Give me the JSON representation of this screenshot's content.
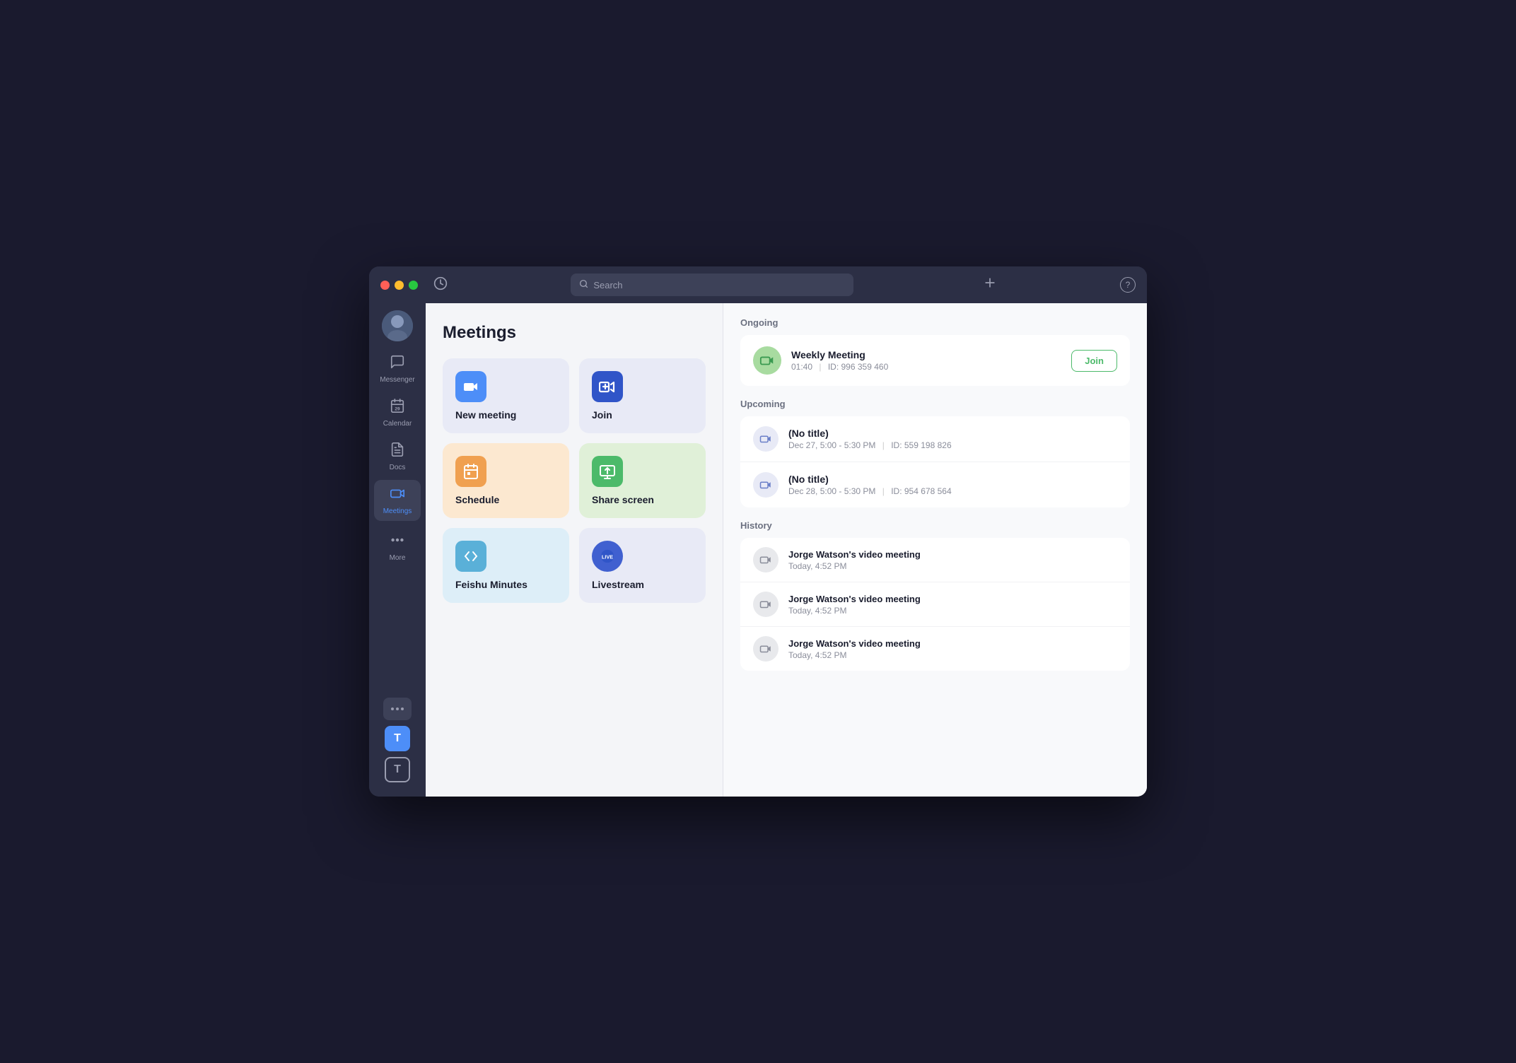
{
  "window": {
    "title": "Meetings"
  },
  "titlebar": {
    "search_placeholder": "Search",
    "help_label": "?"
  },
  "sidebar": {
    "items": [
      {
        "id": "messenger",
        "label": "Messenger",
        "icon": "💬"
      },
      {
        "id": "calendar",
        "label": "Calendar",
        "icon": "📅"
      },
      {
        "id": "docs",
        "label": "Docs",
        "icon": "📄"
      },
      {
        "id": "meetings",
        "label": "Meetings",
        "icon": "🎥",
        "active": true
      }
    ],
    "more_label": "More",
    "badge1": "T",
    "badge2": "T"
  },
  "main": {
    "title": "Meetings",
    "cards": [
      {
        "id": "new-meeting",
        "label": "New meeting",
        "bg": "card-blue",
        "icon_bg": "icon-bg-blue"
      },
      {
        "id": "join",
        "label": "Join",
        "bg": "card-blue",
        "icon_bg": "icon-bg-darkblue"
      },
      {
        "id": "schedule",
        "label": "Schedule",
        "bg": "card-orange",
        "icon_bg": "icon-bg-orange"
      },
      {
        "id": "share-screen",
        "label": "Share screen",
        "bg": "card-green",
        "icon_bg": "icon-bg-green"
      },
      {
        "id": "feishu-minutes",
        "label": "Feishu Minutes",
        "bg": "card-lightblue",
        "icon_bg": "icon-bg-lightblue"
      },
      {
        "id": "livestream",
        "label": "Livestream",
        "bg": "card-blue",
        "icon_bg": "icon-bg-blue2"
      }
    ]
  },
  "ongoing": {
    "section_label": "Ongoing",
    "meeting": {
      "name": "Weekly Meeting",
      "time": "01:40",
      "id_label": "ID: 996 359 460",
      "join_label": "Join"
    }
  },
  "upcoming": {
    "section_label": "Upcoming",
    "items": [
      {
        "title": "(No title)",
        "meta": "Dec 27, 5:00 - 5:30 PM",
        "id_label": "ID: 559 198 826"
      },
      {
        "title": "(No title)",
        "meta": "Dec 28, 5:00 - 5:30 PM",
        "id_label": "ID: 954 678 564"
      }
    ]
  },
  "history": {
    "section_label": "History",
    "items": [
      {
        "name": "Jorge Watson's video meeting",
        "time": "Today, 4:52 PM"
      },
      {
        "name": "Jorge Watson's video meeting",
        "time": "Today, 4:52 PM"
      },
      {
        "name": "Jorge Watson's video meeting",
        "time": "Today, 4:52 PM"
      }
    ]
  }
}
